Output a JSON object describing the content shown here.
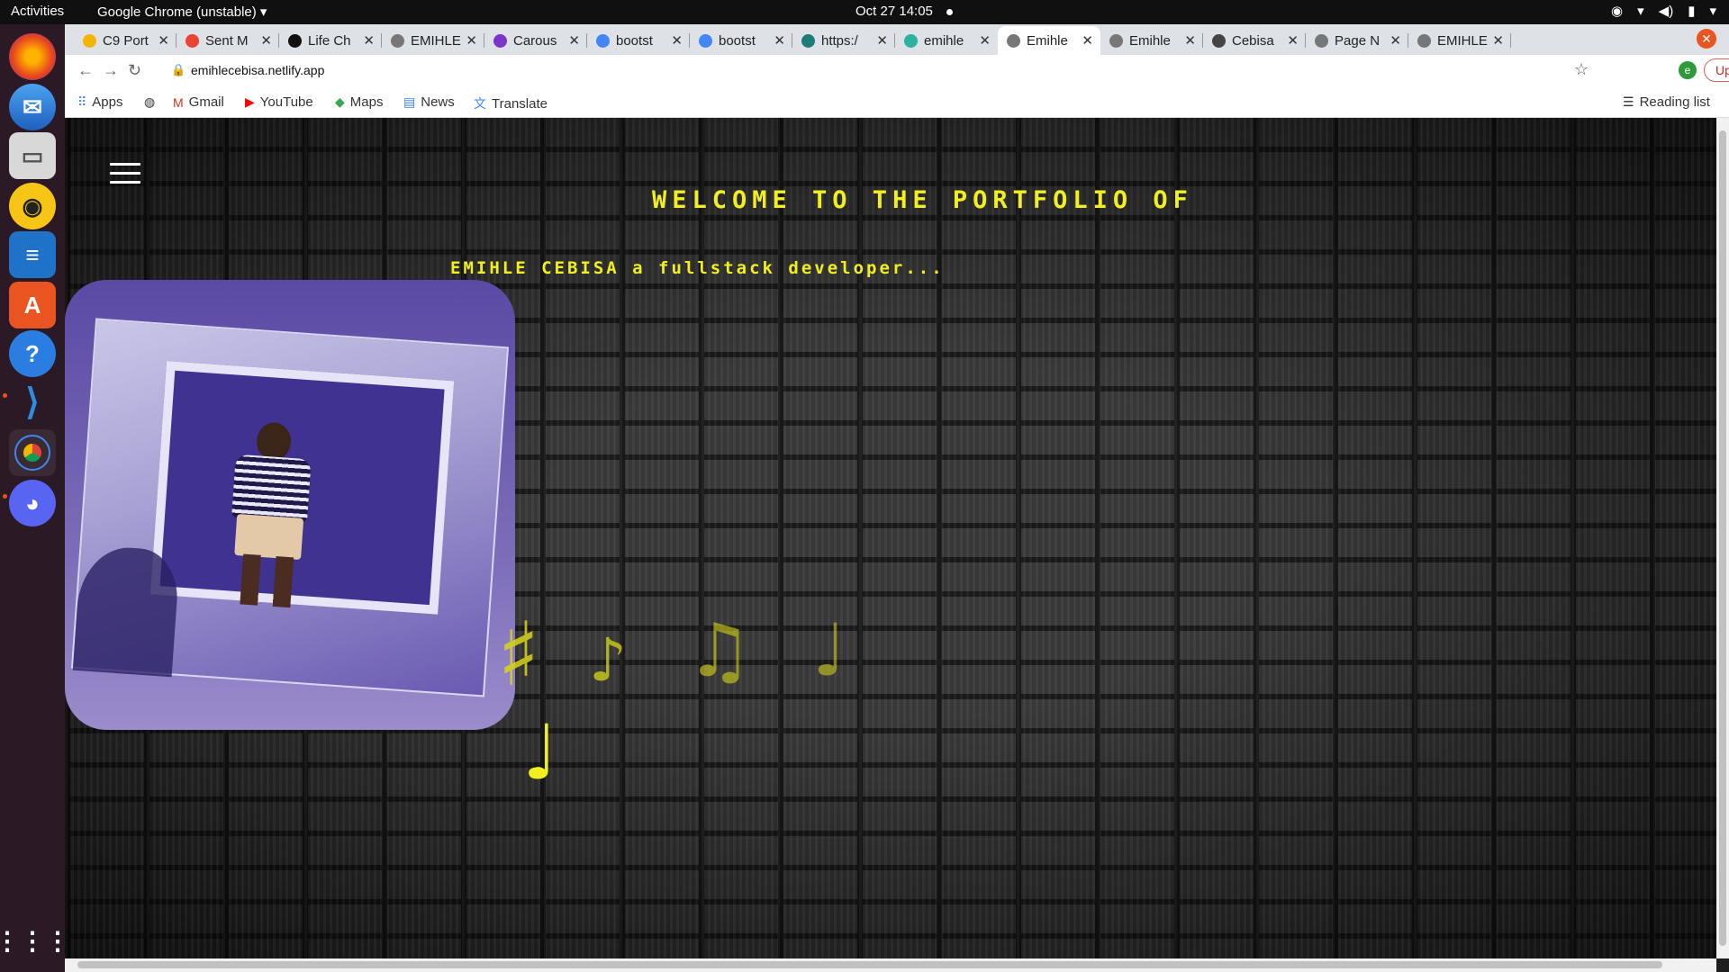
{
  "os": {
    "activities": "Activities",
    "app_name": "Google Chrome (unstable)",
    "clock": "Oct 27  14:05"
  },
  "browser": {
    "tabs": [
      {
        "title": "C9 Port",
        "color": "#f4b400"
      },
      {
        "title": "Sent M",
        "color": "#ea4335"
      },
      {
        "title": "Life Ch",
        "color": "#111111"
      },
      {
        "title": "EMIHLE",
        "color": "#777777"
      },
      {
        "title": "Carous",
        "color": "#7b35c9"
      },
      {
        "title": "bootst",
        "color": "#4285f4"
      },
      {
        "title": "bootst",
        "color": "#4285f4"
      },
      {
        "title": "https:/",
        "color": "#1f7a7a"
      },
      {
        "title": "emihle",
        "color": "#2bb3a0"
      },
      {
        "title": "Emihle",
        "color": "#777777"
      },
      {
        "title": "Emihle",
        "color": "#777777"
      },
      {
        "title": "Cebisa",
        "color": "#444444"
      },
      {
        "title": "Page N",
        "color": "#777777"
      },
      {
        "title": "EMIHLE",
        "color": "#777777"
      }
    ],
    "active_tab_index": 9,
    "url": "emihlecebisa.netlify.app",
    "update_label": "Update",
    "profile_initial": "e",
    "bookmarks": [
      {
        "label": "Apps",
        "icon": "apps-grid-icon"
      },
      {
        "label": "",
        "icon": "globe-icon"
      },
      {
        "label": "Gmail",
        "icon": "gmail-icon"
      },
      {
        "label": "YouTube",
        "icon": "youtube-icon"
      },
      {
        "label": "Maps",
        "icon": "maps-icon"
      },
      {
        "label": "News",
        "icon": "news-icon"
      },
      {
        "label": "Translate",
        "icon": "translate-icon"
      }
    ],
    "reading_list": "Reading list"
  },
  "page": {
    "welcome": "WELCOME TO THE PORTFOLIO OF",
    "subtitle": "EMIHLE CEBISA a fullstack developer...",
    "accent_color": "#f2ef20",
    "notes": [
      "♯",
      "♪",
      "♫",
      "♩",
      "♩"
    ]
  }
}
